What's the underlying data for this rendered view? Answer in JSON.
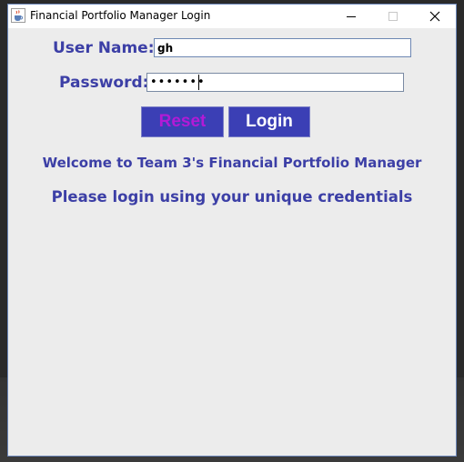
{
  "window": {
    "title": "Financial Portfolio Manager Login",
    "app_icon": "java-cup-icon",
    "controls": {
      "minimize": "minimize-icon",
      "maximize": "maximize-icon",
      "close": "close-icon"
    }
  },
  "form": {
    "username_label": "User Name:",
    "username_value": "gh",
    "password_label": "Password:",
    "password_value": "•••••••"
  },
  "buttons": {
    "reset_label": "Reset",
    "login_label": "Login"
  },
  "messages": {
    "welcome": "Welcome to Team 3's Financial Portfolio Manager",
    "instruction": "Please login using your unique credentials"
  },
  "colors": {
    "label_text": "#3c3fa6",
    "button_bg": "#3b3fb5",
    "reset_text": "#b31ad6",
    "login_text": "#ffffff",
    "window_bg": "#ececec"
  }
}
